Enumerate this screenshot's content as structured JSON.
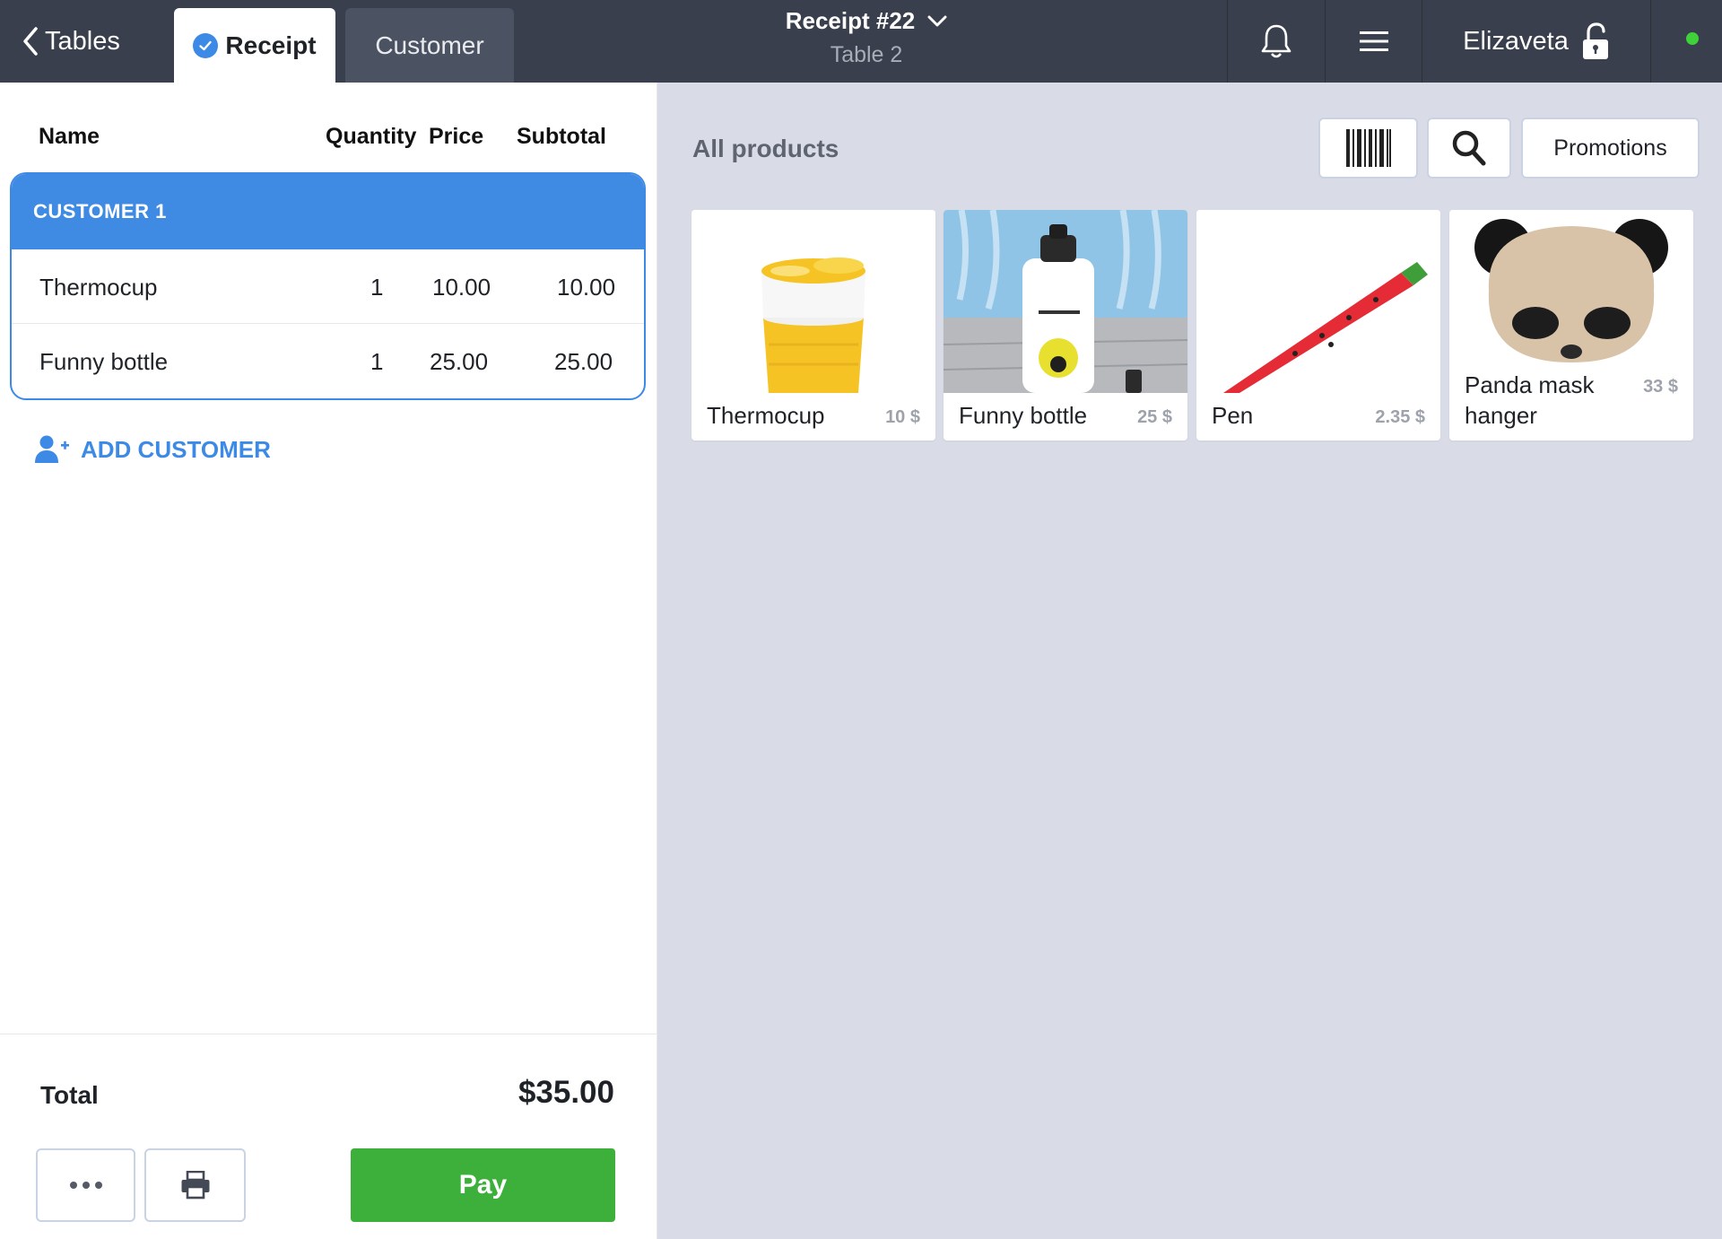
{
  "topbar": {
    "back_label": "Tables",
    "tab_receipt": "Receipt",
    "tab_customer": "Customer",
    "receipt_title": "Receipt #22",
    "table_name": "Table 2",
    "user_name": "Elizaveta",
    "status_color": "#3fd13a"
  },
  "receipt": {
    "columns": {
      "name": "Name",
      "quantity": "Quantity",
      "price": "Price",
      "subtotal": "Subtotal"
    },
    "customer_label": "CUSTOMER 1",
    "items": [
      {
        "name": "Thermocup",
        "quantity": "1",
        "price": "10.00",
        "subtotal": "10.00"
      },
      {
        "name": "Funny bottle",
        "quantity": "1",
        "price": "25.00",
        "subtotal": "25.00"
      }
    ],
    "add_customer_label": "ADD CUSTOMER",
    "total_label": "Total",
    "total_value": "$35.00",
    "pay_label": "Pay"
  },
  "products_panel": {
    "title": "All products",
    "promotions_label": "Promotions",
    "products": [
      {
        "name": "Thermocup",
        "price": "10 $"
      },
      {
        "name": "Funny bottle",
        "price": "25 $"
      },
      {
        "name": "Pen",
        "price": "2.35 $"
      },
      {
        "name": "Panda mask hanger",
        "price": "33 $"
      }
    ]
  },
  "colors": {
    "topbar": "#393f4c",
    "accent_blue": "#3d8ae6",
    "pay_green": "#3cb03a",
    "panel_bg": "#d9dce6"
  },
  "icons": {
    "back": "chevron-left-icon",
    "receipt_tab": "check-circle-icon",
    "title_dropdown": "chevron-down-icon",
    "notifications": "bell-icon",
    "menu": "hamburger-icon",
    "lock": "unlock-icon",
    "add_customer": "user-plus-icon",
    "more": "more-dots-icon",
    "print": "printer-icon",
    "barcode": "barcode-icon",
    "search": "search-icon"
  }
}
